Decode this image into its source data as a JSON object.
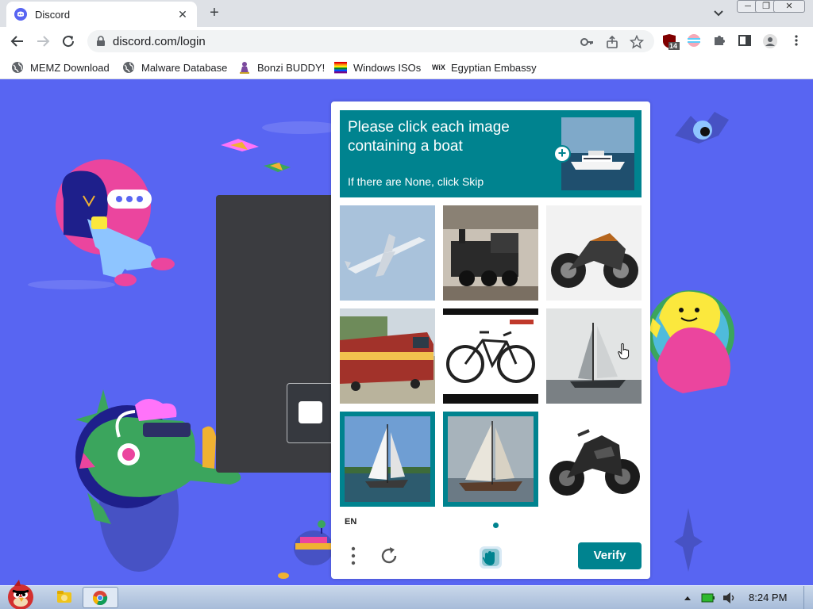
{
  "browser": {
    "tab_title": "Discord",
    "url": "discord.com/login",
    "extension_badge": "14"
  },
  "bookmarks": [
    {
      "label": "MEMZ Download",
      "icon": "globe-icon"
    },
    {
      "label": "Malware Database",
      "icon": "globe-icon"
    },
    {
      "label": "Bonzi BUDDY!",
      "icon": "bonzi-icon"
    },
    {
      "label": "Windows ISOs",
      "icon": "rainbow-icon"
    },
    {
      "label": "Egyptian Embassy",
      "icon": "wix-icon"
    }
  ],
  "captcha": {
    "prompt_line1": "Please click each image",
    "prompt_line2": "containing a boat",
    "prompt_sub": "If there are None, click Skip",
    "language": "EN",
    "verify_label": "Verify",
    "accent_color": "#00838f",
    "images": [
      {
        "subject": "airplane",
        "selected": false
      },
      {
        "subject": "steam-train",
        "selected": false
      },
      {
        "subject": "motorcycle",
        "selected": false
      },
      {
        "subject": "freight-train",
        "selected": false
      },
      {
        "subject": "bicycle",
        "selected": false
      },
      {
        "subject": "sailboat",
        "selected": false
      },
      {
        "subject": "sailboat",
        "selected": true
      },
      {
        "subject": "sailboat",
        "selected": true
      },
      {
        "subject": "motorcycle",
        "selected": false
      }
    ]
  },
  "taskbar": {
    "clock": "8:24 PM"
  },
  "colors": {
    "discord_blurple": "#5865f2",
    "captcha_teal": "#00838f"
  }
}
